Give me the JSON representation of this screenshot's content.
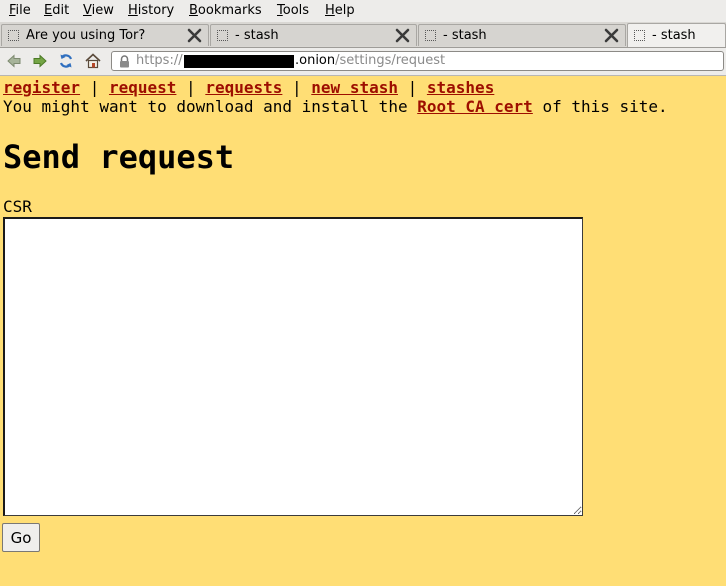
{
  "menubar": {
    "items": [
      {
        "first": "F",
        "rest": "ile"
      },
      {
        "first": "E",
        "rest": "dit"
      },
      {
        "first": "V",
        "rest": "iew"
      },
      {
        "first": "H",
        "rest": "istory"
      },
      {
        "first": "B",
        "rest": "ookmarks"
      },
      {
        "first": "T",
        "rest": "ools"
      },
      {
        "first": "H",
        "rest": "elp"
      }
    ]
  },
  "tabs": [
    {
      "label": "Are you using Tor?",
      "active": false
    },
    {
      "label": "- stash",
      "active": false
    },
    {
      "label": "- stash",
      "active": false
    },
    {
      "label": "- stash",
      "active": true
    }
  ],
  "urlbar": {
    "scheme": "https://",
    "host": ".onion",
    "path": "/settings/request"
  },
  "nav_links": {
    "register": "register",
    "request": "request",
    "requests": "requests",
    "new_stash": "new stash",
    "stashes": "stashes",
    "separator": " | "
  },
  "cert_notice": {
    "prefix": "You might want to download and install the ",
    "link": "Root CA cert",
    "suffix": " of this site."
  },
  "page_title": "Send request",
  "form": {
    "csr_label": "CSR",
    "csr_value": "",
    "submit_label": "Go"
  },
  "colors": {
    "page_background": "#ffde75",
    "link": "#9d0e00"
  }
}
